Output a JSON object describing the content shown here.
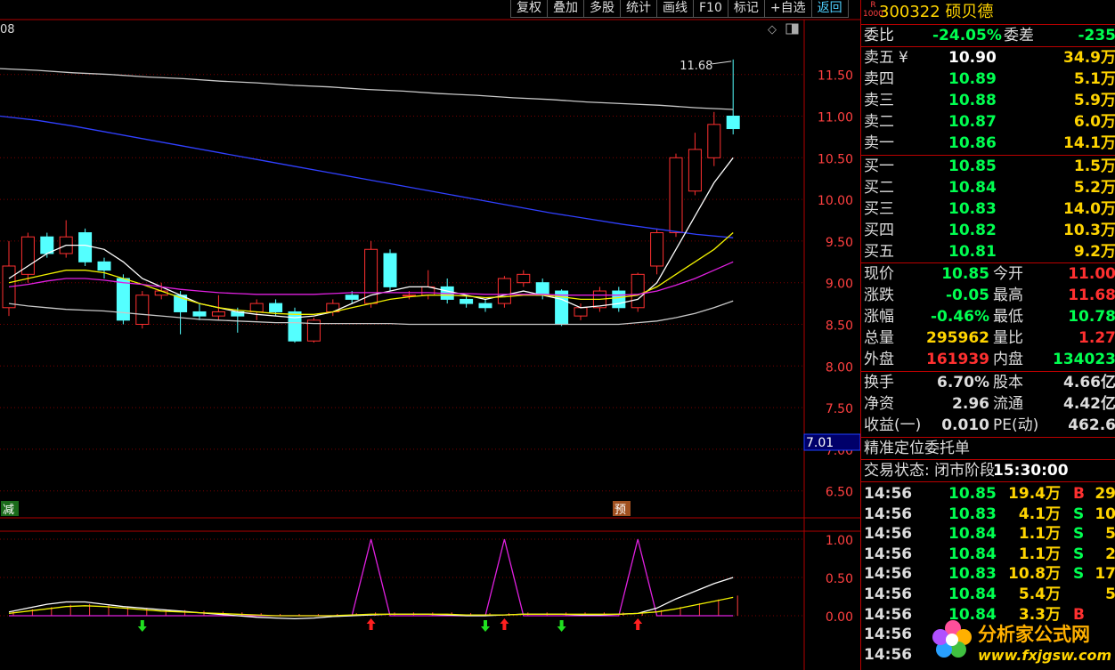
{
  "toolbar": [
    "复权",
    "叠加",
    "多股",
    "统计",
    "画线",
    "F10",
    "标记",
    "+自选",
    "返回"
  ],
  "main_chart": {
    "period_label": "08",
    "peak_label": "11.68",
    "current_price_tag": "7.01",
    "badge_left": "减",
    "badge_right": "预",
    "y_ticks": [
      "11.50",
      "11.00",
      "10.50",
      "10.00",
      "9.50",
      "9.00",
      "8.50",
      "8.00",
      "7.50",
      "7.00",
      "6.50"
    ]
  },
  "sub_chart": {
    "y_ticks": [
      "1.00",
      "0.50",
      "0.00"
    ]
  },
  "chart_data": [
    {
      "type": "candlestick",
      "ylim": [
        6.5,
        11.68
      ],
      "up_color": "#ff3030",
      "down_color": "#54ffff",
      "candles": [
        {
          "o": 8.7,
          "c": 9.2,
          "h": 9.5,
          "l": 8.6
        },
        {
          "o": 9.1,
          "c": 9.55,
          "h": 9.6,
          "l": 9.0
        },
        {
          "o": 9.55,
          "c": 9.35,
          "h": 9.6,
          "l": 9.3
        },
        {
          "o": 9.35,
          "c": 9.55,
          "h": 9.75,
          "l": 9.3
        },
        {
          "o": 9.6,
          "c": 9.25,
          "h": 9.65,
          "l": 9.2
        },
        {
          "o": 9.25,
          "c": 9.15,
          "h": 9.3,
          "l": 9.05
        },
        {
          "o": 9.05,
          "c": 8.55,
          "h": 9.1,
          "l": 8.5
        },
        {
          "o": 8.5,
          "c": 8.85,
          "h": 8.9,
          "l": 8.45
        },
        {
          "o": 8.85,
          "c": 8.9,
          "h": 9.0,
          "l": 8.8
        },
        {
          "o": 8.85,
          "c": 8.65,
          "h": 8.9,
          "l": 8.38
        },
        {
          "o": 8.65,
          "c": 8.6,
          "h": 8.75,
          "l": 8.55
        },
        {
          "o": 8.6,
          "c": 8.65,
          "h": 8.85,
          "l": 8.55
        },
        {
          "o": 8.65,
          "c": 8.6,
          "h": 8.7,
          "l": 8.4
        },
        {
          "o": 8.65,
          "c": 8.75,
          "h": 8.8,
          "l": 8.55
        },
        {
          "o": 8.75,
          "c": 8.65,
          "h": 8.8,
          "l": 8.6
        },
        {
          "o": 8.65,
          "c": 8.3,
          "h": 8.7,
          "l": 8.28
        },
        {
          "o": 8.3,
          "c": 8.55,
          "h": 8.58,
          "l": 8.28
        },
        {
          "o": 8.65,
          "c": 8.75,
          "h": 8.8,
          "l": 8.6
        },
        {
          "o": 8.85,
          "c": 8.8,
          "h": 8.9,
          "l": 8.75
        },
        {
          "o": 8.75,
          "c": 9.4,
          "h": 9.5,
          "l": 8.7
        },
        {
          "o": 9.35,
          "c": 8.95,
          "h": 9.4,
          "l": 8.9
        },
        {
          "o": 8.85,
          "c": 8.85,
          "h": 8.9,
          "l": 8.8
        },
        {
          "o": 8.85,
          "c": 8.95,
          "h": 9.15,
          "l": 8.8
        },
        {
          "o": 8.95,
          "c": 8.8,
          "h": 9.05,
          "l": 8.75
        },
        {
          "o": 8.8,
          "c": 8.75,
          "h": 8.85,
          "l": 8.7
        },
        {
          "o": 8.75,
          "c": 8.7,
          "h": 8.8,
          "l": 8.65
        },
        {
          "o": 8.75,
          "c": 9.05,
          "h": 9.08,
          "l": 8.7
        },
        {
          "o": 9.0,
          "c": 9.1,
          "h": 9.15,
          "l": 8.95
        },
        {
          "o": 9.0,
          "c": 8.85,
          "h": 9.05,
          "l": 8.8
        },
        {
          "o": 8.9,
          "c": 8.5,
          "h": 8.92,
          "l": 8.48
        },
        {
          "o": 8.6,
          "c": 8.7,
          "h": 8.75,
          "l": 8.55
        },
        {
          "o": 8.7,
          "c": 8.9,
          "h": 8.95,
          "l": 8.65
        },
        {
          "o": 8.9,
          "c": 8.7,
          "h": 8.95,
          "l": 8.65
        },
        {
          "o": 8.7,
          "c": 9.1,
          "h": 9.12,
          "l": 8.65
        },
        {
          "o": 9.2,
          "c": 9.6,
          "h": 9.65,
          "l": 9.1
        },
        {
          "o": 9.6,
          "c": 10.5,
          "h": 10.55,
          "l": 9.55
        },
        {
          "o": 10.1,
          "c": 10.6,
          "h": 10.8,
          "l": 10.05
        },
        {
          "o": 10.5,
          "c": 10.9,
          "h": 11.05,
          "l": 10.4
        },
        {
          "o": 11.0,
          "c": 10.85,
          "h": 11.68,
          "l": 10.78
        }
      ],
      "ma_lines": [
        {
          "color": "#ffffff",
          "values": [
            9.05,
            9.2,
            9.35,
            9.45,
            9.45,
            9.4,
            9.25,
            9.05,
            8.95,
            8.85,
            8.75,
            8.7,
            8.65,
            8.62,
            8.6,
            8.58,
            8.6,
            8.65,
            8.75,
            8.85,
            8.9,
            8.95,
            8.95,
            8.9,
            8.85,
            8.8,
            8.85,
            8.9,
            8.85,
            8.8,
            8.7,
            8.72,
            8.75,
            8.8,
            9.0,
            9.4,
            9.8,
            10.2,
            10.5
          ]
        },
        {
          "color": "#f0f000",
          "values": [
            9.0,
            9.05,
            9.1,
            9.15,
            9.15,
            9.12,
            9.05,
            8.98,
            8.9,
            8.82,
            8.75,
            8.7,
            8.67,
            8.65,
            8.63,
            8.62,
            8.62,
            8.65,
            8.7,
            8.75,
            8.8,
            8.83,
            8.85,
            8.85,
            8.84,
            8.82,
            8.83,
            8.85,
            8.85,
            8.83,
            8.8,
            8.8,
            8.82,
            8.85,
            8.95,
            9.1,
            9.25,
            9.4,
            9.6
          ]
        },
        {
          "color": "#e020e0",
          "values": [
            8.95,
            8.98,
            9.02,
            9.05,
            9.05,
            9.03,
            9.0,
            8.98,
            8.95,
            8.92,
            8.9,
            8.88,
            8.87,
            8.86,
            8.86,
            8.86,
            8.86,
            8.87,
            8.88,
            8.88,
            8.88,
            8.88,
            8.88,
            8.87,
            8.87,
            8.86,
            8.86,
            8.86,
            8.86,
            8.85,
            8.85,
            8.85,
            8.85,
            8.86,
            8.9,
            8.97,
            9.05,
            9.15,
            9.25
          ]
        },
        {
          "color": "#c8c8c8",
          "values": [
            8.75,
            8.72,
            8.7,
            8.68,
            8.67,
            8.66,
            8.64,
            8.62,
            8.6,
            8.58,
            8.56,
            8.55,
            8.54,
            8.53,
            8.52,
            8.52,
            8.51,
            8.51,
            8.51,
            8.51,
            8.51,
            8.5,
            8.5,
            8.5,
            8.5,
            8.5,
            8.5,
            8.5,
            8.5,
            8.5,
            8.5,
            8.5,
            8.5,
            8.52,
            8.54,
            8.58,
            8.63,
            8.7,
            8.78
          ]
        }
      ],
      "long_ma": [
        {
          "color": "#c8c8c8",
          "values": [
            11.57,
            11.55,
            11.52,
            11.5,
            11.47,
            11.45,
            11.42,
            11.4,
            11.37,
            11.35,
            11.32,
            11.3,
            11.27,
            11.25,
            11.22,
            11.2,
            11.17,
            11.15,
            11.13,
            11.1,
            11.08
          ]
        },
        {
          "color": "#3040ff",
          "values": [
            11.0,
            10.95,
            10.88,
            10.8,
            10.72,
            10.64,
            10.56,
            10.48,
            10.4,
            10.32,
            10.24,
            10.16,
            10.08,
            10.0,
            9.92,
            9.84,
            9.77,
            9.7,
            9.64,
            9.58,
            9.54
          ]
        }
      ]
    },
    {
      "type": "line",
      "ylim": [
        0,
        1.0
      ],
      "series": [
        {
          "color": "#e020e0",
          "values": [
            0,
            0,
            0,
            0,
            0,
            0,
            0,
            0,
            0,
            0,
            0,
            0,
            0,
            0,
            0,
            0,
            0,
            0,
            0,
            1.0,
            0,
            0,
            0,
            0,
            0,
            0,
            1.0,
            0,
            0,
            0,
            0,
            0,
            0,
            1.0,
            0,
            0,
            0,
            0,
            0
          ]
        },
        {
          "color": "#ffffff",
          "values": [
            0.05,
            0.1,
            0.15,
            0.18,
            0.18,
            0.15,
            0.12,
            0.1,
            0.08,
            0.06,
            0.04,
            0.02,
            0.0,
            -0.02,
            -0.03,
            -0.04,
            -0.03,
            -0.01,
            0.0,
            0.01,
            0.02,
            0.02,
            0.02,
            0.01,
            0.0,
            0.0,
            0.01,
            0.02,
            0.02,
            0.02,
            0.01,
            0.01,
            0.02,
            0.03,
            0.1,
            0.22,
            0.32,
            0.42,
            0.5
          ]
        },
        {
          "color": "#f0f000",
          "values": [
            0.03,
            0.06,
            0.09,
            0.12,
            0.13,
            0.12,
            0.1,
            0.08,
            0.06,
            0.05,
            0.04,
            0.03,
            0.02,
            0.01,
            0.0,
            0.0,
            0.0,
            0.0,
            0.01,
            0.02,
            0.02,
            0.02,
            0.02,
            0.02,
            0.01,
            0.01,
            0.01,
            0.02,
            0.02,
            0.02,
            0.02,
            0.02,
            0.02,
            0.03,
            0.05,
            0.09,
            0.14,
            0.19,
            0.24
          ]
        }
      ],
      "up_arrows": [
        19,
        26,
        33
      ],
      "down_arrows": [
        7,
        25,
        29
      ]
    }
  ],
  "quote": {
    "code": "300322",
    "name": "硕贝德",
    "r_badge": "R",
    "r_sub": "1000",
    "weibi_label": "委比",
    "weibi": "-24.05%",
    "weicha_label": "委差",
    "weicha": "-235",
    "yen": "¥",
    "asks": [
      {
        "label": "卖五",
        "price": "10.90",
        "vol": "34.9万"
      },
      {
        "label": "卖四",
        "price": "10.89",
        "vol": "5.1万"
      },
      {
        "label": "卖三",
        "price": "10.88",
        "vol": "5.9万"
      },
      {
        "label": "卖二",
        "price": "10.87",
        "vol": "6.0万"
      },
      {
        "label": "卖一",
        "price": "10.86",
        "vol": "14.1万"
      }
    ],
    "bids": [
      {
        "label": "买一",
        "price": "10.85",
        "vol": "1.5万"
      },
      {
        "label": "买二",
        "price": "10.84",
        "vol": "5.2万"
      },
      {
        "label": "买三",
        "price": "10.83",
        "vol": "14.0万"
      },
      {
        "label": "买四",
        "price": "10.82",
        "vol": "10.3万"
      },
      {
        "label": "买五",
        "price": "10.81",
        "vol": "9.2万"
      }
    ],
    "stats1": [
      {
        "l1": "现价",
        "v1": "10.85",
        "c1": "#00ff50",
        "l2": "今开",
        "v2": "11.00",
        "c2": "#ff3030"
      },
      {
        "l1": "涨跌",
        "v1": "-0.05",
        "c1": "#00ff50",
        "l2": "最高",
        "v2": "11.68",
        "c2": "#ff3030"
      },
      {
        "l1": "涨幅",
        "v1": "-0.46%",
        "c1": "#00ff50",
        "l2": "最低",
        "v2": "10.78",
        "c2": "#00ff50"
      },
      {
        "l1": "总量",
        "v1": "295962",
        "c1": "#ffd400",
        "l2": "量比",
        "v2": "1.27",
        "c2": "#ff3030"
      },
      {
        "l1": "外盘",
        "v1": "161939",
        "c1": "#ff3030",
        "l2": "内盘",
        "v2": "134023",
        "c2": "#00ff50"
      }
    ],
    "stats2": [
      {
        "l1": "换手",
        "v1": "6.70%",
        "l2": "股本",
        "v2": "4.66亿"
      },
      {
        "l1": "净资",
        "v1": "2.96",
        "l2": "流通",
        "v2": "4.42亿"
      },
      {
        "l1": "收益(一)",
        "v1": "0.010",
        "l2": "PE(动)",
        "v2": "462.6"
      }
    ],
    "section_title": "精准定位委托单",
    "trade_status_label": "交易状态: 闭市阶段",
    "trade_status_time": "15:30:00",
    "ticks": [
      {
        "t": "14:56",
        "p": "10.85",
        "pc": "#00ff50",
        "v": "19.4万",
        "bs": "B",
        "bc": "#ff3030",
        "n": "29"
      },
      {
        "t": "14:56",
        "p": "10.83",
        "pc": "#00ff50",
        "v": "4.1万",
        "bs": "S",
        "bc": "#00ff50",
        "n": "10"
      },
      {
        "t": "14:56",
        "p": "10.84",
        "pc": "#00ff50",
        "v": "1.1万",
        "bs": "S",
        "bc": "#00ff50",
        "n": "5"
      },
      {
        "t": "14:56",
        "p": "10.84",
        "pc": "#00ff50",
        "v": "1.1万",
        "bs": "S",
        "bc": "#00ff50",
        "n": "2"
      },
      {
        "t": "14:56",
        "p": "10.83",
        "pc": "#00ff50",
        "v": "10.8万",
        "bs": "S",
        "bc": "#00ff50",
        "n": "17"
      },
      {
        "t": "14:56",
        "p": "10.84",
        "pc": "#00ff50",
        "v": "5.4万",
        "bs": "",
        "bc": "#00ff50",
        "n": "5"
      },
      {
        "t": "14:56",
        "p": "10.84",
        "pc": "#00ff50",
        "v": "3.3万",
        "bs": "B",
        "bc": "#ff3030",
        "n": ""
      },
      {
        "t": "14:56",
        "p": "",
        "pc": "#00ff50",
        "v": "",
        "bs": "",
        "bc": "#00ff50",
        "n": ""
      },
      {
        "t": "14:56",
        "p": "",
        "pc": "#00ff50",
        "v": "",
        "bs": "",
        "bc": "#00ff50",
        "n": ""
      }
    ]
  },
  "watermark": {
    "text": "分析家公式网",
    "url": "www.fxjgsw.com"
  }
}
